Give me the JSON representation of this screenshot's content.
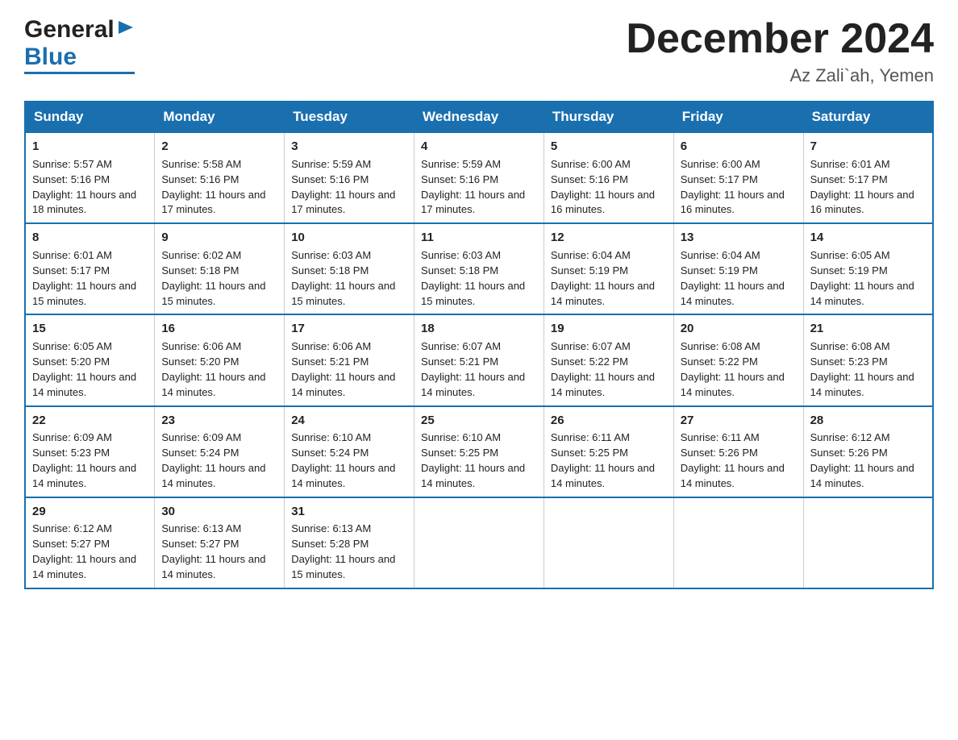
{
  "header": {
    "logo_general": "General",
    "logo_blue": "Blue",
    "month_title": "December 2024",
    "location": "Az Zali`ah, Yemen"
  },
  "days": [
    "Sunday",
    "Monday",
    "Tuesday",
    "Wednesday",
    "Thursday",
    "Friday",
    "Saturday"
  ],
  "weeks": [
    [
      {
        "num": "1",
        "rise": "5:57 AM",
        "set": "5:16 PM",
        "daylight": "11 hours and 18 minutes."
      },
      {
        "num": "2",
        "rise": "5:58 AM",
        "set": "5:16 PM",
        "daylight": "11 hours and 17 minutes."
      },
      {
        "num": "3",
        "rise": "5:59 AM",
        "set": "5:16 PM",
        "daylight": "11 hours and 17 minutes."
      },
      {
        "num": "4",
        "rise": "5:59 AM",
        "set": "5:16 PM",
        "daylight": "11 hours and 17 minutes."
      },
      {
        "num": "5",
        "rise": "6:00 AM",
        "set": "5:16 PM",
        "daylight": "11 hours and 16 minutes."
      },
      {
        "num": "6",
        "rise": "6:00 AM",
        "set": "5:17 PM",
        "daylight": "11 hours and 16 minutes."
      },
      {
        "num": "7",
        "rise": "6:01 AM",
        "set": "5:17 PM",
        "daylight": "11 hours and 16 minutes."
      }
    ],
    [
      {
        "num": "8",
        "rise": "6:01 AM",
        "set": "5:17 PM",
        "daylight": "11 hours and 15 minutes."
      },
      {
        "num": "9",
        "rise": "6:02 AM",
        "set": "5:18 PM",
        "daylight": "11 hours and 15 minutes."
      },
      {
        "num": "10",
        "rise": "6:03 AM",
        "set": "5:18 PM",
        "daylight": "11 hours and 15 minutes."
      },
      {
        "num": "11",
        "rise": "6:03 AM",
        "set": "5:18 PM",
        "daylight": "11 hours and 15 minutes."
      },
      {
        "num": "12",
        "rise": "6:04 AM",
        "set": "5:19 PM",
        "daylight": "11 hours and 14 minutes."
      },
      {
        "num": "13",
        "rise": "6:04 AM",
        "set": "5:19 PM",
        "daylight": "11 hours and 14 minutes."
      },
      {
        "num": "14",
        "rise": "6:05 AM",
        "set": "5:19 PM",
        "daylight": "11 hours and 14 minutes."
      }
    ],
    [
      {
        "num": "15",
        "rise": "6:05 AM",
        "set": "5:20 PM",
        "daylight": "11 hours and 14 minutes."
      },
      {
        "num": "16",
        "rise": "6:06 AM",
        "set": "5:20 PM",
        "daylight": "11 hours and 14 minutes."
      },
      {
        "num": "17",
        "rise": "6:06 AM",
        "set": "5:21 PM",
        "daylight": "11 hours and 14 minutes."
      },
      {
        "num": "18",
        "rise": "6:07 AM",
        "set": "5:21 PM",
        "daylight": "11 hours and 14 minutes."
      },
      {
        "num": "19",
        "rise": "6:07 AM",
        "set": "5:22 PM",
        "daylight": "11 hours and 14 minutes."
      },
      {
        "num": "20",
        "rise": "6:08 AM",
        "set": "5:22 PM",
        "daylight": "11 hours and 14 minutes."
      },
      {
        "num": "21",
        "rise": "6:08 AM",
        "set": "5:23 PM",
        "daylight": "11 hours and 14 minutes."
      }
    ],
    [
      {
        "num": "22",
        "rise": "6:09 AM",
        "set": "5:23 PM",
        "daylight": "11 hours and 14 minutes."
      },
      {
        "num": "23",
        "rise": "6:09 AM",
        "set": "5:24 PM",
        "daylight": "11 hours and 14 minutes."
      },
      {
        "num": "24",
        "rise": "6:10 AM",
        "set": "5:24 PM",
        "daylight": "11 hours and 14 minutes."
      },
      {
        "num": "25",
        "rise": "6:10 AM",
        "set": "5:25 PM",
        "daylight": "11 hours and 14 minutes."
      },
      {
        "num": "26",
        "rise": "6:11 AM",
        "set": "5:25 PM",
        "daylight": "11 hours and 14 minutes."
      },
      {
        "num": "27",
        "rise": "6:11 AM",
        "set": "5:26 PM",
        "daylight": "11 hours and 14 minutes."
      },
      {
        "num": "28",
        "rise": "6:12 AM",
        "set": "5:26 PM",
        "daylight": "11 hours and 14 minutes."
      }
    ],
    [
      {
        "num": "29",
        "rise": "6:12 AM",
        "set": "5:27 PM",
        "daylight": "11 hours and 14 minutes."
      },
      {
        "num": "30",
        "rise": "6:13 AM",
        "set": "5:27 PM",
        "daylight": "11 hours and 14 minutes."
      },
      {
        "num": "31",
        "rise": "6:13 AM",
        "set": "5:28 PM",
        "daylight": "11 hours and 15 minutes."
      },
      null,
      null,
      null,
      null
    ]
  ]
}
